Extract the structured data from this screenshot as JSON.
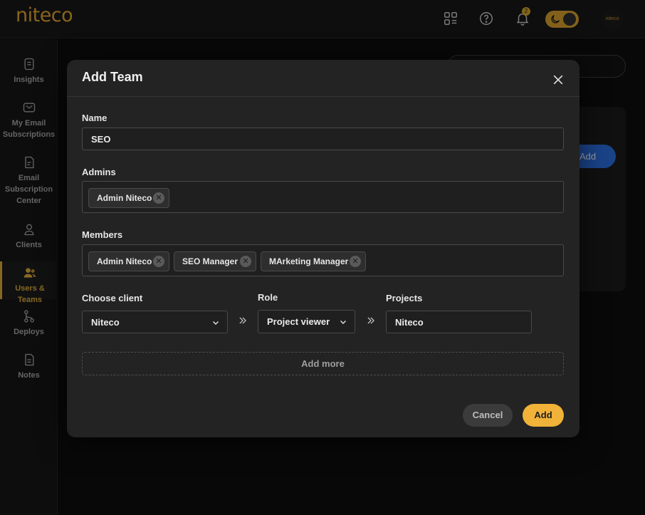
{
  "app": {
    "logo": "niteco",
    "avatar": "niteco",
    "notification_count": "2"
  },
  "topbar_icons": [
    "apps-icon",
    "help-icon",
    "bell-icon",
    "moon-icon"
  ],
  "sidebar": {
    "items": [
      {
        "label": "Insights",
        "icon": "document-icon"
      },
      {
        "label": "My Email Subscriptions",
        "icon": "mail-icon"
      },
      {
        "label": "Email Subscription Center",
        "icon": "file-icon"
      },
      {
        "label": "Clients",
        "icon": "user-icon"
      },
      {
        "label": "Users & Teams",
        "icon": "users-icon",
        "active": true
      },
      {
        "label": "Deploys",
        "icon": "branch-icon"
      },
      {
        "label": "Notes",
        "icon": "note-icon"
      }
    ]
  },
  "background": {
    "add_team_button": "Add Team"
  },
  "modal": {
    "title": "Add Team",
    "name_label": "Name",
    "name_value": "SEO",
    "admins_label": "Admins",
    "admins": [
      "Admin Niteco"
    ],
    "members_label": "Members",
    "members": [
      "Admin Niteco",
      "SEO Manager",
      "MArketing Manager"
    ],
    "client_label": "Choose client",
    "client_value": "Niteco",
    "role_label": "Role",
    "role_value": "Project viewer",
    "projects_label": "Projects",
    "projects_value": "Niteco",
    "add_more": "Add more",
    "cancel": "Cancel",
    "add": "Add"
  },
  "colors": {
    "accent": "#f0b238",
    "brand": "#d59a2c",
    "primary_blue": "#2868d2"
  }
}
